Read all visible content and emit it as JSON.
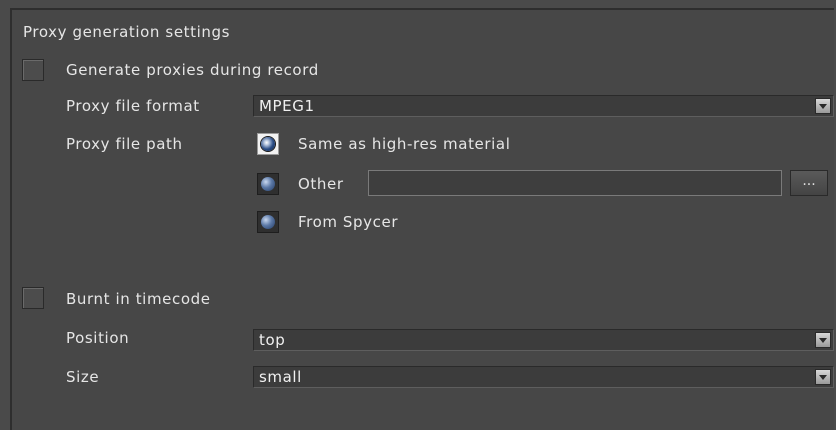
{
  "section_title": "Proxy generation settings",
  "generate_proxies": {
    "label": "Generate proxies during record",
    "checked": false
  },
  "proxy_file_format": {
    "label": "Proxy file format",
    "value": "MPEG1"
  },
  "proxy_file_path": {
    "label": "Proxy file path",
    "options": [
      {
        "label": "Same as high-res material",
        "selected": true
      },
      {
        "label": "Other",
        "selected": false
      },
      {
        "label": "From Spycer",
        "selected": false
      }
    ],
    "other_path_value": "",
    "browse_label": "..."
  },
  "burnt_in_timecode": {
    "label": "Burnt in timecode",
    "checked": false
  },
  "position": {
    "label": "Position",
    "value": "top"
  },
  "size": {
    "label": "Size",
    "value": "small"
  },
  "icons": {
    "dropdown": "chevron-down-icon",
    "radio_selected": "radio-selected-icon",
    "radio_unselected": "radio-unselected-icon"
  }
}
